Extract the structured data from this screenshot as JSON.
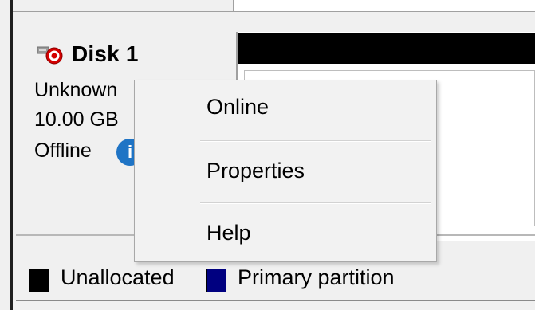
{
  "disk": {
    "title": "Disk 1",
    "type": "Unknown",
    "size": "10.00 GB",
    "status": "Offline",
    "info_icon_glyph": "i",
    "offline_badge_color": "#d40000",
    "disk_icon": "offline-disk-icon",
    "status_icon": "info-icon"
  },
  "context_menu": {
    "items": [
      {
        "label": "Online"
      },
      {
        "label": "Properties"
      },
      {
        "label": "Help"
      }
    ]
  },
  "legend": {
    "items": [
      {
        "label": "Unallocated",
        "color": "#000000"
      },
      {
        "label": "Primary partition",
        "color": "#000080"
      }
    ]
  }
}
